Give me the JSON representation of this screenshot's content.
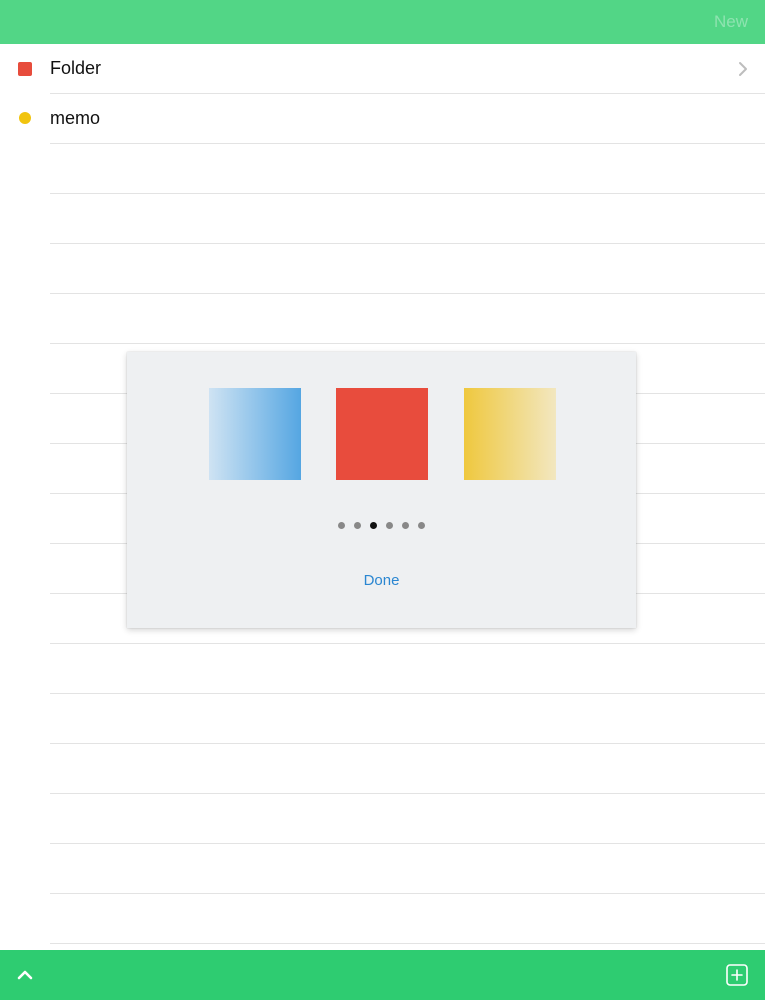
{
  "topbar": {
    "new_label": "New"
  },
  "list": {
    "items": [
      {
        "label": "Folder",
        "icon": "folder-square-icon",
        "color": "#e74c3c",
        "has_chevron": true
      },
      {
        "label": "memo",
        "icon": "memo-dot-icon",
        "color": "#f1c40f",
        "has_chevron": false
      }
    ]
  },
  "picker": {
    "swatches": [
      {
        "name": "blue",
        "color_from": "#cfe3f3",
        "color_to": "#55a6e2"
      },
      {
        "name": "red",
        "color": "#e84c3d"
      },
      {
        "name": "yellow",
        "color_from": "#efc83e",
        "color_to": "#f2e7c0"
      }
    ],
    "page_count": 6,
    "active_page": 3,
    "done_label": "Done"
  },
  "bottombar": {
    "left_icon": "chevron-up-icon",
    "right_icon": "add-square-icon"
  },
  "colors": {
    "topbar": "#52d686",
    "bottombar": "#2ecc71",
    "accent_link": "#2a86d1"
  }
}
